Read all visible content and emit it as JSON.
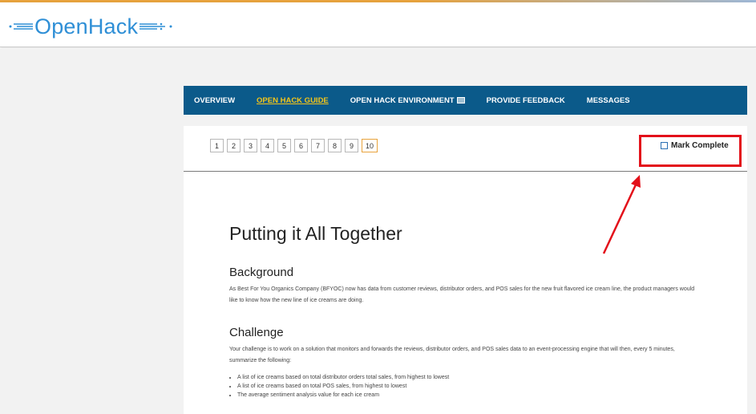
{
  "brand": {
    "name": "OpenHack",
    "color": "#2f8fd6"
  },
  "nav": {
    "items": [
      {
        "label": "OVERVIEW",
        "active": false
      },
      {
        "label": "OPEN HACK GUIDE",
        "active": true
      },
      {
        "label": "OPEN HACK ENVIRONMENT",
        "active": false
      },
      {
        "label": "PROVIDE FEEDBACK",
        "active": false
      },
      {
        "label": "MESSAGES",
        "active": false
      }
    ],
    "background": "#0b5a8a",
    "active_color": "#f5c518"
  },
  "pager": {
    "pages": [
      "1",
      "2",
      "3",
      "4",
      "5",
      "6",
      "7",
      "8",
      "9",
      "10"
    ],
    "current": "10"
  },
  "mark_complete": {
    "label": "Mark Complete",
    "highlight_color": "#e3101a"
  },
  "content": {
    "title": "Putting it All Together",
    "background_heading": "Background",
    "background_text": "As Best For You Organics Company (BFYOC) now has data from customer reviews, distributor orders, and POS sales for the new fruit flavored ice cream line, the product managers would like to know how the new line of ice creams are doing.",
    "challenge_heading": "Challenge",
    "challenge_text": "Your challenge is to work on a solution that monitors and forwards the reviews, distributor orders, and POS sales data to an event-processing engine that will then, every 5 minutes, summarize the following:",
    "bullets": [
      "A list of ice creams based on total distributor orders total sales, from highest to lowest",
      "A list of ice creams based on total POS sales, from highest to lowest",
      "The average sentiment analysis value for each ice cream"
    ]
  }
}
